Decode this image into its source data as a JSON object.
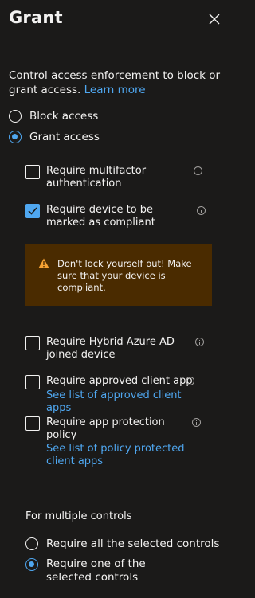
{
  "panel": {
    "title": "Grant",
    "description": "Control access enforcement to block or grant access.",
    "learn_more": "Learn more"
  },
  "access": {
    "block_label": "Block access",
    "grant_label": "Grant access",
    "selected": "grant"
  },
  "controls": {
    "mfa": {
      "label": "Require multifactor authentication",
      "checked": false
    },
    "compliant": {
      "label": "Require device to be marked as compliant",
      "checked": true
    },
    "warning_text": "Don't lock yourself out! Make sure that your device is compliant.",
    "hybrid": {
      "label": "Require Hybrid Azure AD joined device",
      "checked": false
    },
    "approved_app": {
      "label": "Require approved client app",
      "link": "See list of approved client apps",
      "checked": false
    },
    "app_protection": {
      "label": "Require app protection policy",
      "link": "See list of policy protected client apps",
      "checked": false
    }
  },
  "multiple": {
    "label": "For multiple controls",
    "all_label": "Require all the selected controls",
    "one_label": "Require one of the selected controls",
    "selected": "one"
  },
  "colors": {
    "accent": "#4fa7f0",
    "warning_bg": "#4a2b00",
    "warning_icon": "#f7a233",
    "background": "#1b1a19"
  }
}
